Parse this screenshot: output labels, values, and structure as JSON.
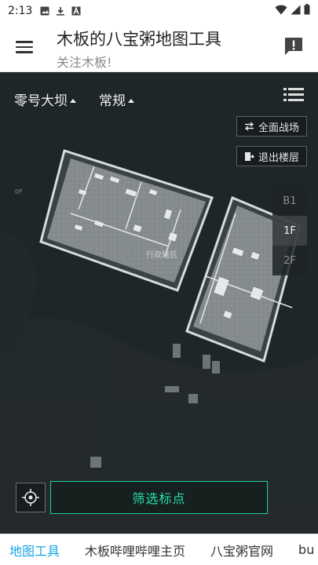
{
  "status_bar": {
    "time": "2:13"
  },
  "app_bar": {
    "title": "木板的八宝粥地图工具",
    "subtitle": "关注木板!"
  },
  "map": {
    "map_select": "零号大坝",
    "mode_select": "常规",
    "buttons": {
      "full_battlefield": "全面战场",
      "exit_floor": "退出楼层",
      "filter": "筛选标点"
    },
    "floors": [
      {
        "label": "B1",
        "active": false
      },
      {
        "label": "1F",
        "active": true
      },
      {
        "label": "2F",
        "active": false
      }
    ],
    "area_label": "行政辖区",
    "floor_mark": "0F"
  },
  "tabs": [
    "地图工具",
    "木板哔哩哔哩主页",
    "八宝粥官网",
    "bu"
  ],
  "colors": {
    "accent": "#27e0a7",
    "tab_active": "#1aa6e8",
    "map_background": "#1d2426"
  }
}
